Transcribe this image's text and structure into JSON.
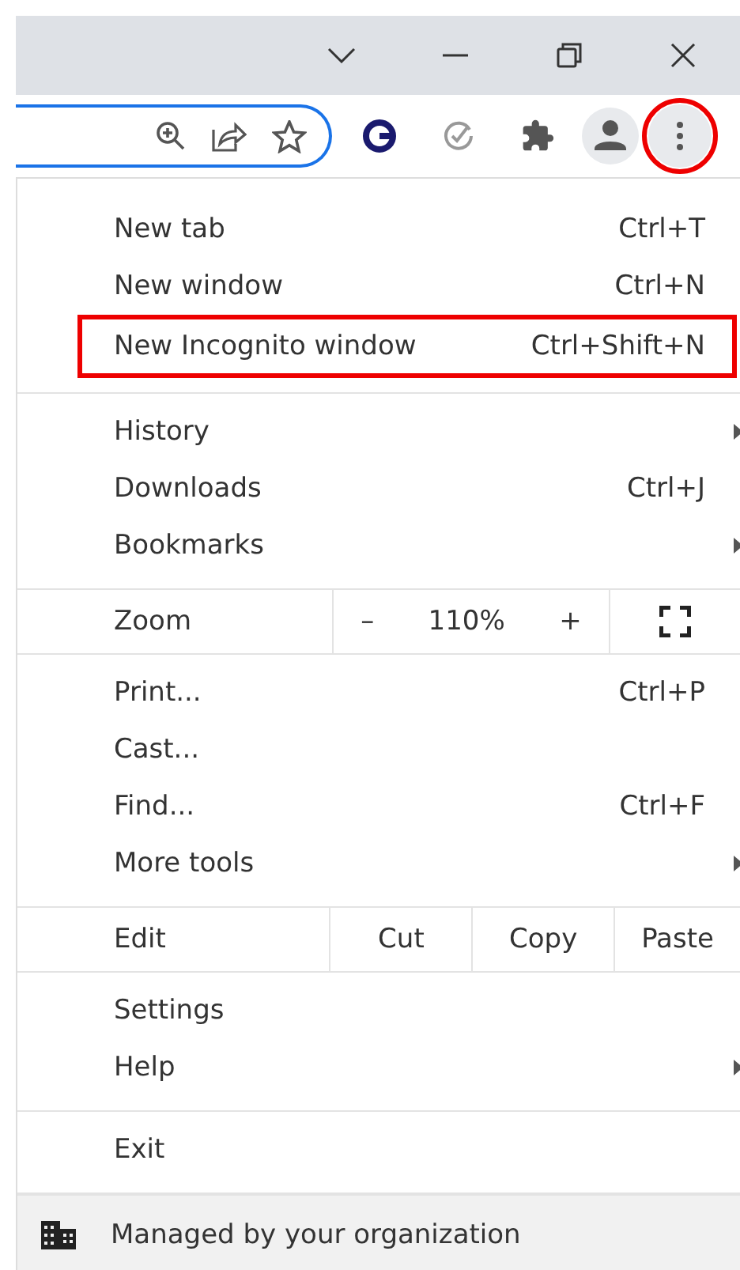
{
  "toolbar": {
    "menu_button_circled": true
  },
  "menu": {
    "sections": [
      {
        "items": [
          {
            "kind": "item",
            "label": "New tab",
            "shortcut": "Ctrl+T",
            "submenu": false,
            "boxed": false
          },
          {
            "kind": "item",
            "label": "New window",
            "shortcut": "Ctrl+N",
            "submenu": false,
            "boxed": false
          },
          {
            "kind": "item",
            "label": "New Incognito window",
            "shortcut": "Ctrl+Shift+N",
            "submenu": false,
            "boxed": true
          }
        ]
      },
      {
        "items": [
          {
            "kind": "item",
            "label": "History",
            "submenu": true,
            "boxed": false
          },
          {
            "kind": "item",
            "label": "Downloads",
            "shortcut": "Ctrl+J",
            "submenu": false,
            "boxed": false
          },
          {
            "kind": "item",
            "label": "Bookmarks",
            "submenu": true,
            "boxed": false
          }
        ]
      },
      {
        "items": [
          {
            "kind": "zoom",
            "label": "Zoom",
            "minus": "–",
            "value": "110%",
            "plus": "+"
          }
        ]
      },
      {
        "items": [
          {
            "kind": "item",
            "label": "Print...",
            "shortcut": "Ctrl+P",
            "submenu": false,
            "boxed": false
          },
          {
            "kind": "item",
            "label": "Cast...",
            "submenu": false,
            "boxed": false
          },
          {
            "kind": "item",
            "label": "Find...",
            "shortcut": "Ctrl+F",
            "submenu": false,
            "boxed": false
          },
          {
            "kind": "item",
            "label": "More tools",
            "submenu": true,
            "boxed": false
          }
        ]
      },
      {
        "items": [
          {
            "kind": "edit",
            "label": "Edit",
            "actions": [
              "Cut",
              "Copy",
              "Paste"
            ]
          }
        ]
      },
      {
        "items": [
          {
            "kind": "item",
            "label": "Settings",
            "submenu": false,
            "boxed": false
          },
          {
            "kind": "item",
            "label": "Help",
            "submenu": true,
            "boxed": false
          }
        ]
      },
      {
        "items": [
          {
            "kind": "item",
            "label": "Exit",
            "submenu": false,
            "boxed": false
          }
        ]
      }
    ],
    "footer": "Managed by your organization"
  }
}
